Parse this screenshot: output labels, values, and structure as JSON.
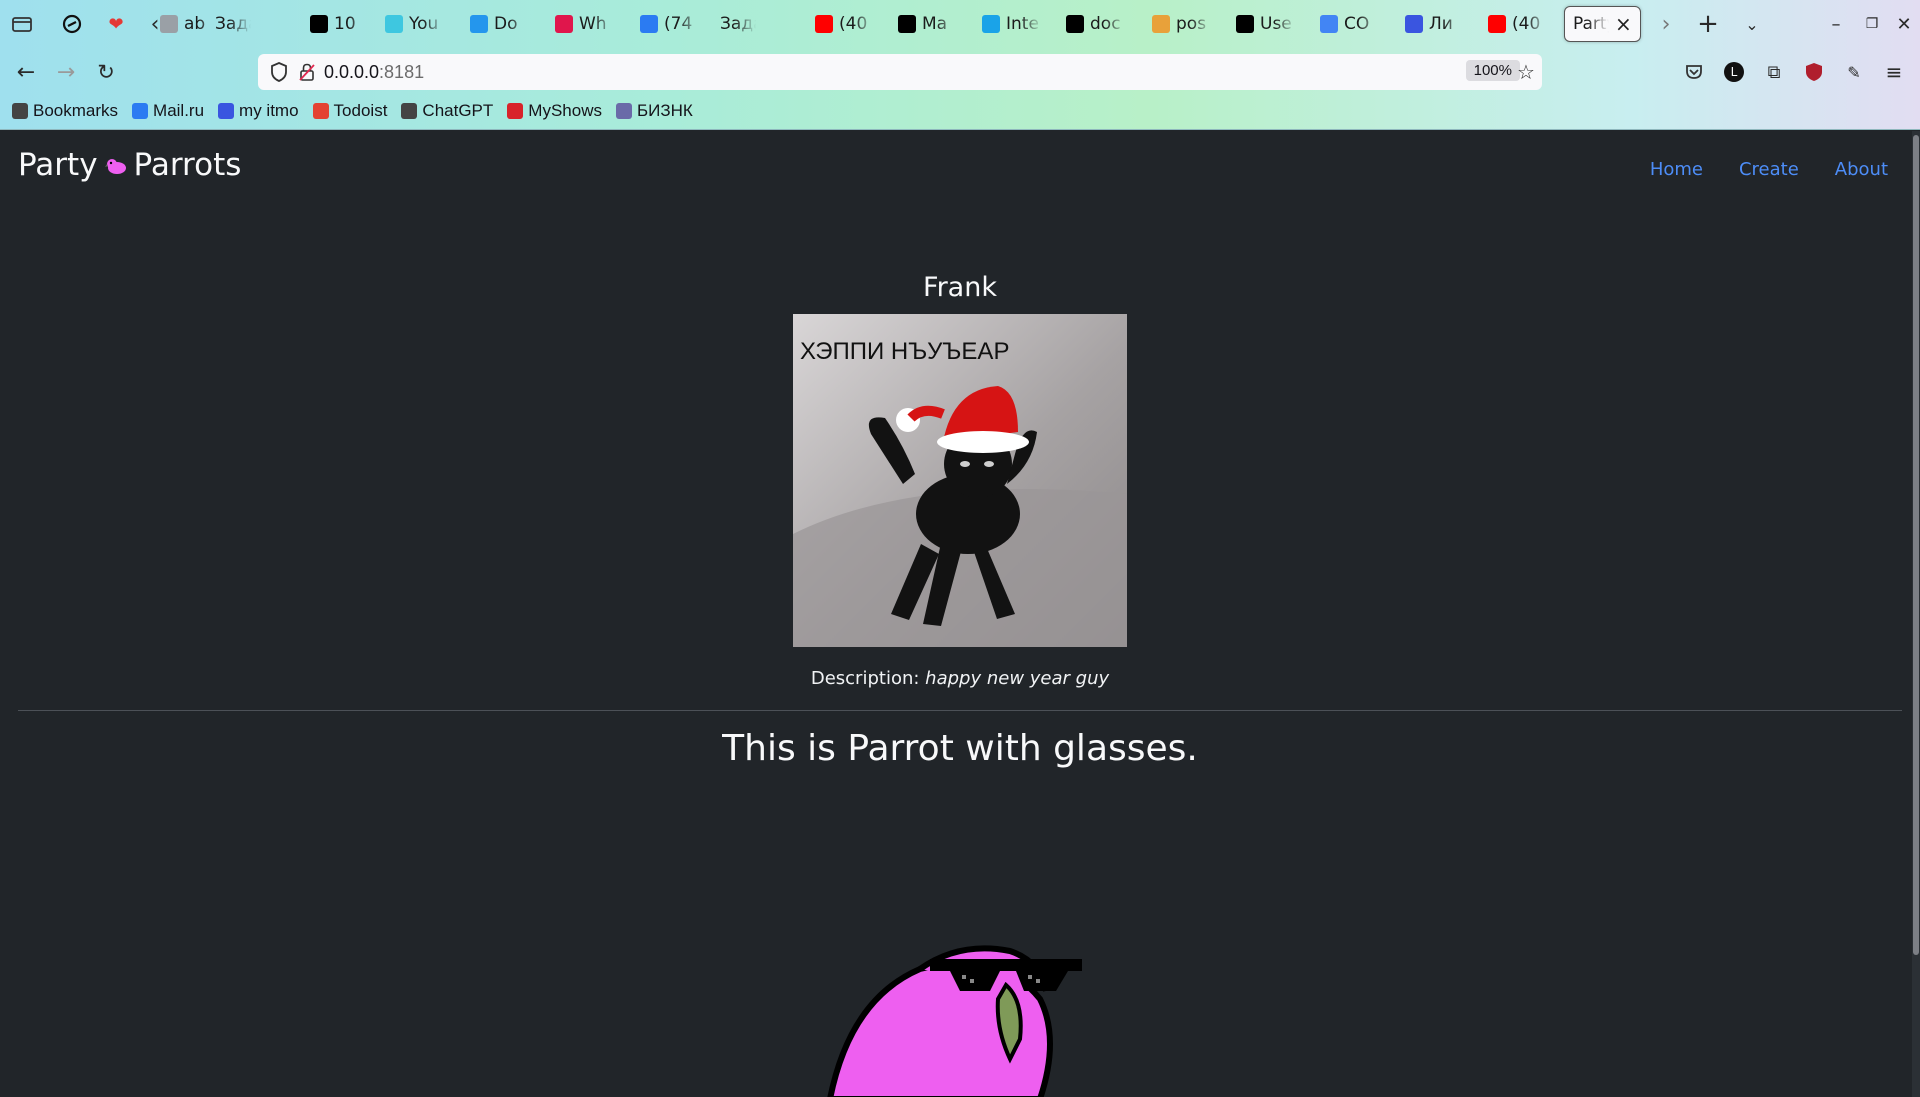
{
  "browser": {
    "tabs": [
      {
        "label": "ab",
        "icon": "chevron-left-icon",
        "color": "#9aa0a6"
      },
      {
        "label": "Задан",
        "icon": "",
        "color": "#9aa0a6"
      },
      {
        "label": "10",
        "icon": "dev-icon",
        "color": "#000000"
      },
      {
        "label": "You",
        "icon": "youtube-music-icon",
        "color": "#3ec7e0"
      },
      {
        "label": "Do",
        "icon": "docker-icon",
        "color": "#2496ed"
      },
      {
        "label": "Wh",
        "icon": "wh-icon",
        "color": "#e0164c"
      },
      {
        "label": "(74",
        "icon": "mail-icon",
        "color": "#2b7bf2"
      },
      {
        "label": "Задан",
        "icon": "",
        "color": "#9aa0a6"
      },
      {
        "label": "(40",
        "icon": "youtube-icon",
        "color": "#ff0000"
      },
      {
        "label": "Ma",
        "icon": "dev-icon",
        "color": "#000000"
      },
      {
        "label": "Inte",
        "icon": "edge-icon",
        "color": "#1aa3e8"
      },
      {
        "label": "doc",
        "icon": "github-icon",
        "color": "#000000"
      },
      {
        "label": "pos",
        "icon": "pos-icon",
        "color": "#e8a13a"
      },
      {
        "label": "Use",
        "icon": "notion-icon",
        "color": "#000000"
      },
      {
        "label": "CO",
        "icon": "google-icon",
        "color": "#4285f4"
      },
      {
        "label": "Ли",
        "icon": "itmo-icon",
        "color": "#3a55e0"
      },
      {
        "label": "(40",
        "icon": "youtube-icon",
        "color": "#ff0000"
      },
      {
        "label": "Party",
        "icon": "",
        "color": "#9aa0a6",
        "active": true
      }
    ],
    "url_host": "0.0.0.0",
    "url_port": ":8181",
    "zoom": "100%",
    "bookmarks": [
      {
        "label": "Bookmarks",
        "icon": "folder-icon",
        "color": "#444444"
      },
      {
        "label": "Mail.ru",
        "icon": "mail-icon",
        "color": "#2b7bf2"
      },
      {
        "label": "my itmo",
        "icon": "itmo-icon",
        "color": "#3a55e0"
      },
      {
        "label": "Todoist",
        "icon": "todoist-icon",
        "color": "#e44232"
      },
      {
        "label": "ChatGPT",
        "icon": "chatgpt-icon",
        "color": "#444444"
      },
      {
        "label": "MyShows",
        "icon": "tv-icon",
        "color": "#d8232a"
      },
      {
        "label": "БИЗНК",
        "icon": "cube-icon",
        "color": "#6a6aa8"
      }
    ]
  },
  "site": {
    "brand_left": "Party",
    "brand_right": "Parrots",
    "nav": [
      "Home",
      "Create",
      "About"
    ],
    "card": {
      "title": "Frank",
      "image_caption": "ХЭППИ НЪУЪЕАР",
      "description_label": "Description:",
      "description_value": "happy new year guy"
    },
    "headline": "This is Parrot with glasses."
  },
  "colors": {
    "page_bg": "#212529",
    "link": "#4d8df7",
    "parrot_pink": "#ee5ff0"
  }
}
